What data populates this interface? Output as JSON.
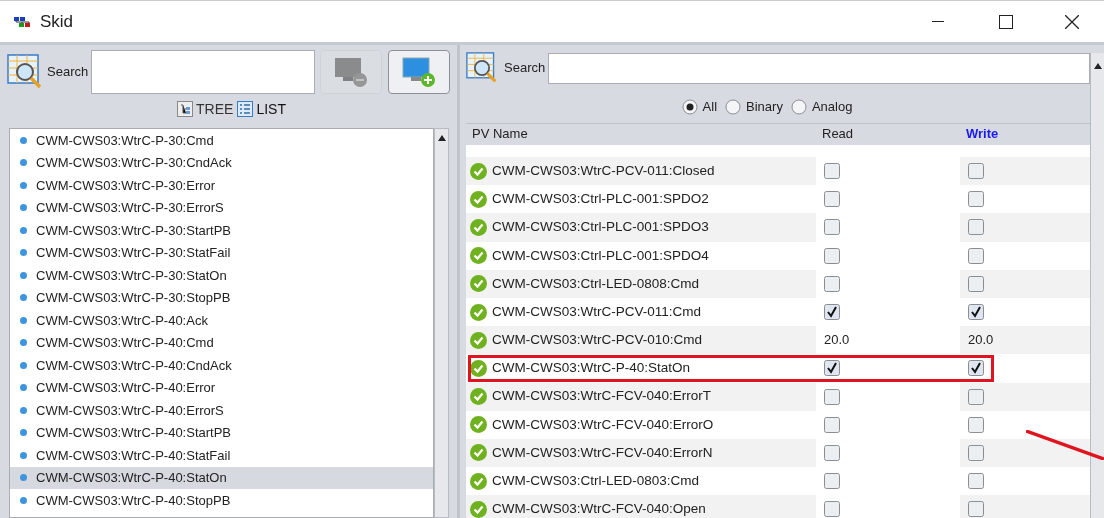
{
  "window": {
    "title": "Skid"
  },
  "left_panel": {
    "search": {
      "label": "Search"
    },
    "remove_button": {
      "disabled": true
    },
    "add_button": {
      "disabled": false
    },
    "views": [
      {
        "label": "TREE",
        "selected": false
      },
      {
        "label": "LIST",
        "selected": true
      }
    ],
    "items": [
      {
        "label": "CWM-CWS03:WtrC-P-30:Cmd",
        "selected": false
      },
      {
        "label": "CWM-CWS03:WtrC-P-30:CndAck",
        "selected": false
      },
      {
        "label": "CWM-CWS03:WtrC-P-30:Error",
        "selected": false
      },
      {
        "label": "CWM-CWS03:WtrC-P-30:ErrorS",
        "selected": false
      },
      {
        "label": "CWM-CWS03:WtrC-P-30:StartPB",
        "selected": false
      },
      {
        "label": "CWM-CWS03:WtrC-P-30:StatFail",
        "selected": false
      },
      {
        "label": "CWM-CWS03:WtrC-P-30:StatOn",
        "selected": false
      },
      {
        "label": "CWM-CWS03:WtrC-P-30:StopPB",
        "selected": false
      },
      {
        "label": "CWM-CWS03:WtrC-P-40:Ack",
        "selected": false
      },
      {
        "label": "CWM-CWS03:WtrC-P-40:Cmd",
        "selected": false
      },
      {
        "label": "CWM-CWS03:WtrC-P-40:CndAck",
        "selected": false
      },
      {
        "label": "CWM-CWS03:WtrC-P-40:Error",
        "selected": false
      },
      {
        "label": "CWM-CWS03:WtrC-P-40:ErrorS",
        "selected": false
      },
      {
        "label": "CWM-CWS03:WtrC-P-40:StartPB",
        "selected": false
      },
      {
        "label": "CWM-CWS03:WtrC-P-40:StatFail",
        "selected": false
      },
      {
        "label": "CWM-CWS03:WtrC-P-40:StatOn",
        "selected": true
      },
      {
        "label": "CWM-CWS03:WtrC-P-40:StopPB",
        "selected": false
      }
    ]
  },
  "right_panel": {
    "search": {
      "label": "Search"
    },
    "filters": [
      {
        "label": "All",
        "selected": true
      },
      {
        "label": "Binary",
        "selected": false
      },
      {
        "label": "Analog",
        "selected": false
      }
    ],
    "table": {
      "columns": [
        "PV Name",
        "Read",
        "Write"
      ],
      "rows": [
        {
          "name": "CWM-CWS03:WtrC-PCV-011:Closed",
          "highlighted": false,
          "read": {
            "kind": "checkbox",
            "checked": false
          },
          "write": {
            "kind": "checkbox",
            "checked": false
          }
        },
        {
          "name": "CWM-CWS03:Ctrl-PLC-001:SPDO2",
          "highlighted": false,
          "read": {
            "kind": "checkbox",
            "checked": false
          },
          "write": {
            "kind": "checkbox",
            "checked": false
          }
        },
        {
          "name": "CWM-CWS03:Ctrl-PLC-001:SPDO3",
          "highlighted": false,
          "read": {
            "kind": "checkbox",
            "checked": false
          },
          "write": {
            "kind": "checkbox",
            "checked": false
          }
        },
        {
          "name": "CWM-CWS03:Ctrl-PLC-001:SPDO4",
          "highlighted": false,
          "read": {
            "kind": "checkbox",
            "checked": false
          },
          "write": {
            "kind": "checkbox",
            "checked": false
          }
        },
        {
          "name": "CWM-CWS03:Ctrl-LED-0808:Cmd",
          "highlighted": false,
          "read": {
            "kind": "checkbox",
            "checked": false
          },
          "write": {
            "kind": "checkbox",
            "checked": false
          }
        },
        {
          "name": "CWM-CWS03:WtrC-PCV-011:Cmd",
          "highlighted": false,
          "read": {
            "kind": "checkbox",
            "checked": true
          },
          "write": {
            "kind": "checkbox",
            "checked": true
          }
        },
        {
          "name": "CWM-CWS03:WtrC-PCV-010:Cmd",
          "highlighted": false,
          "read": {
            "kind": "value",
            "value": "20.0"
          },
          "write": {
            "kind": "value",
            "value": "20.0"
          }
        },
        {
          "name": "CWM-CWS03:WtrC-P-40:StatOn",
          "highlighted": true,
          "read": {
            "kind": "checkbox",
            "checked": true
          },
          "write": {
            "kind": "checkbox",
            "checked": true
          }
        },
        {
          "name": "CWM-CWS03:WtrC-FCV-040:ErrorT",
          "highlighted": false,
          "read": {
            "kind": "checkbox",
            "checked": false
          },
          "write": {
            "kind": "checkbox",
            "checked": false
          }
        },
        {
          "name": "CWM-CWS03:WtrC-FCV-040:ErrorO",
          "highlighted": false,
          "read": {
            "kind": "checkbox",
            "checked": false
          },
          "write": {
            "kind": "checkbox",
            "checked": false
          }
        },
        {
          "name": "CWM-CWS03:WtrC-FCV-040:ErrorN",
          "highlighted": false,
          "read": {
            "kind": "checkbox",
            "checked": false
          },
          "write": {
            "kind": "checkbox",
            "checked": false
          }
        },
        {
          "name": "CWM-CWS03:Ctrl-LED-0803:Cmd",
          "highlighted": false,
          "read": {
            "kind": "checkbox",
            "checked": false
          },
          "write": {
            "kind": "checkbox",
            "checked": false
          }
        },
        {
          "name": "CWM-CWS03:WtrC-FCV-040:Open",
          "highlighted": false,
          "read": {
            "kind": "checkbox",
            "checked": false
          },
          "write": {
            "kind": "checkbox",
            "checked": false
          }
        }
      ]
    }
  }
}
